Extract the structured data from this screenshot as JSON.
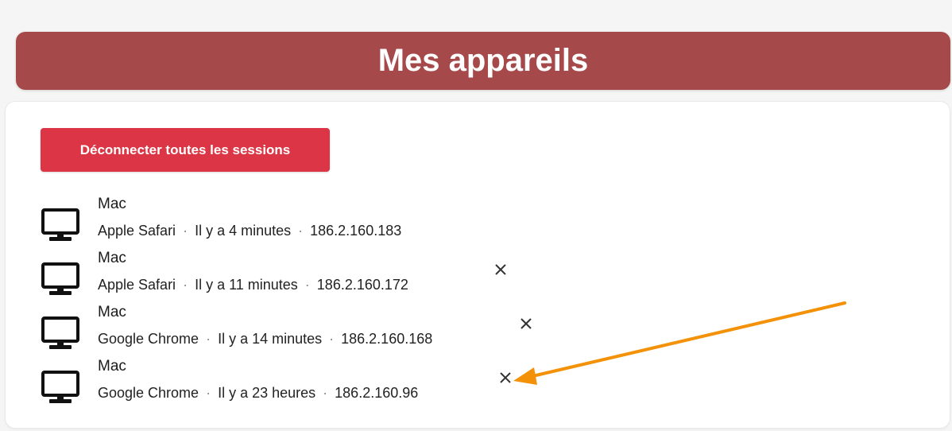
{
  "page_title": "Mes appareils",
  "logout_all_label": "Déconnecter toutes les sessions",
  "colors": {
    "header": "#a6494a",
    "button": "#dc3545",
    "annotation_arrow": "#f39208"
  },
  "devices": [
    {
      "name": "Mac",
      "browser": "Apple Safari",
      "last_seen": "Il y a 4 minutes",
      "ip": "186.2.160.183",
      "icon": "desktop-monitor-icon",
      "has_close": false
    },
    {
      "name": "Mac",
      "browser": "Apple Safari",
      "last_seen": "Il y a 11 minutes",
      "ip": "186.2.160.172",
      "icon": "desktop-monitor-icon",
      "has_close": true
    },
    {
      "name": "Mac",
      "browser": "Google Chrome",
      "last_seen": "Il y a 14 minutes",
      "ip": "186.2.160.168",
      "icon": "desktop-monitor-icon",
      "has_close": true
    },
    {
      "name": "Mac",
      "browser": "Google Chrome",
      "last_seen": "Il y a 23 heures",
      "ip": "186.2.160.96",
      "icon": "desktop-monitor-icon",
      "has_close": true
    }
  ],
  "separator": "·"
}
